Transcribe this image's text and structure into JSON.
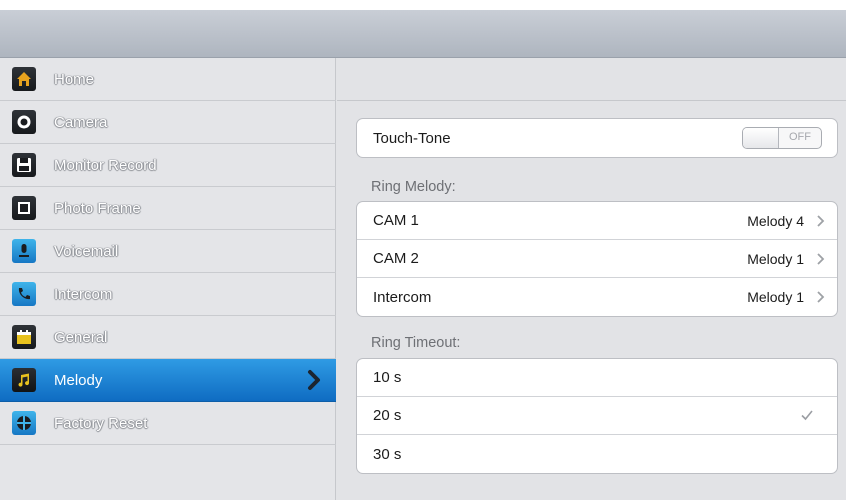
{
  "sidebar": {
    "items": [
      {
        "label": "Home",
        "icon": "home-icon"
      },
      {
        "label": "Camera",
        "icon": "camera-icon"
      },
      {
        "label": "Monitor Record",
        "icon": "floppy-disk-icon"
      },
      {
        "label": "Photo Frame",
        "icon": "photo-frame-icon"
      },
      {
        "label": "Voicemail",
        "icon": "microphone-icon"
      },
      {
        "label": "Intercom",
        "icon": "phone-icon"
      },
      {
        "label": "General",
        "icon": "calendar-icon"
      },
      {
        "label": "Melody",
        "icon": "music-note-icon",
        "active": true
      },
      {
        "label": "Factory Reset",
        "icon": "reset-icon"
      }
    ]
  },
  "settings": {
    "touch_tone": {
      "label": "Touch-Tone",
      "state": "OFF"
    },
    "ring_melody": {
      "header": "Ring Melody:",
      "rows": [
        {
          "label": "CAM 1",
          "value": "Melody 4"
        },
        {
          "label": "CAM 2",
          "value": "Melody 1"
        },
        {
          "label": "Intercom",
          "value": "Melody 1"
        }
      ]
    },
    "ring_timeout": {
      "header": "Ring Timeout:",
      "options": [
        {
          "label": "10 s",
          "selected": false
        },
        {
          "label": "20 s",
          "selected": true
        },
        {
          "label": "30 s",
          "selected": false
        }
      ]
    }
  },
  "colors": {
    "active_item": "#1e85d6",
    "title_bar": "#b6bcc5",
    "background": "#e2e3e6"
  }
}
